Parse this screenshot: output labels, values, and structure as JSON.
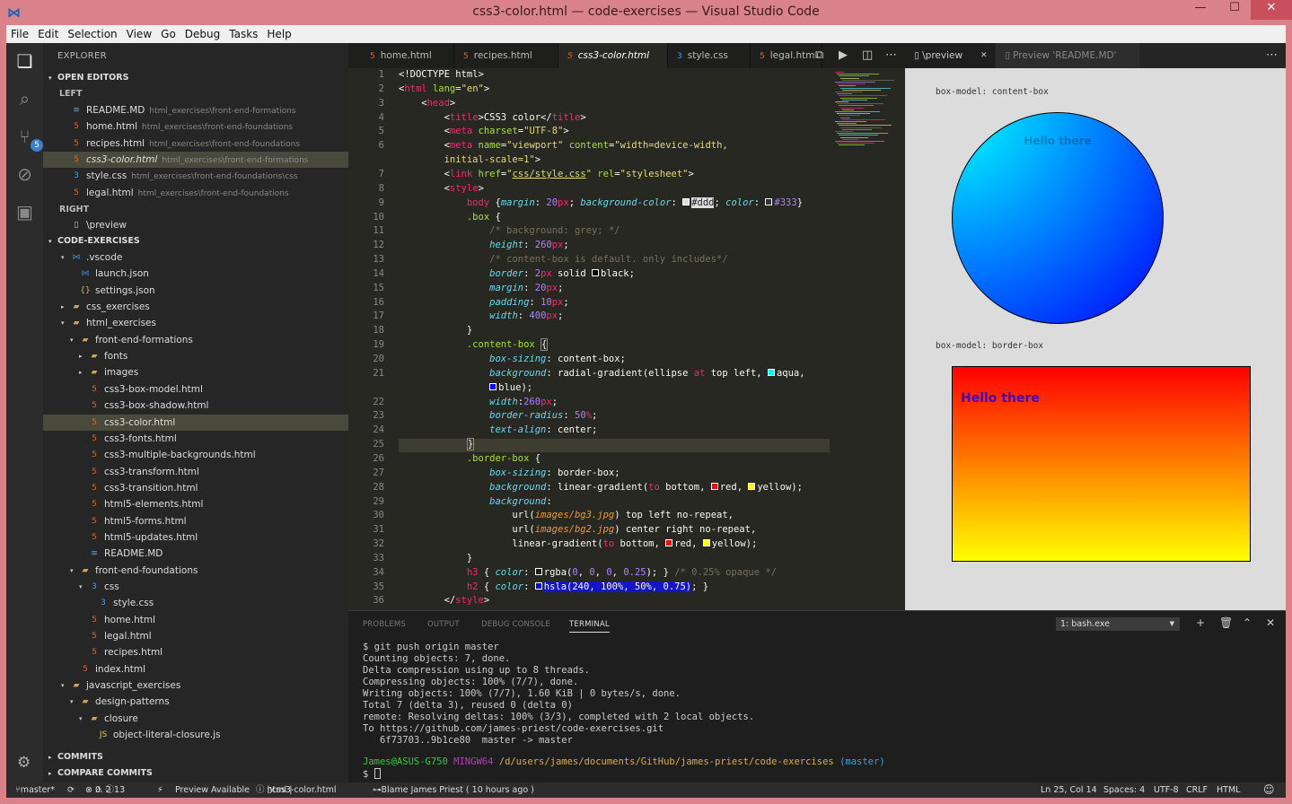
{
  "window": {
    "title": "css3-color.html — code-exercises — Visual Studio Code",
    "minimize": "—",
    "maximize": "☐",
    "close": "✕",
    "logo": "⋈"
  },
  "menu": [
    "File",
    "Edit",
    "Selection",
    "View",
    "Go",
    "Debug",
    "Tasks",
    "Help"
  ],
  "activity": {
    "git_badge": "5"
  },
  "sidebar": {
    "title": "EXPLORER",
    "open_editors": "OPEN EDITORS",
    "left_group": "LEFT",
    "right_group": "RIGHT",
    "open_left": [
      {
        "name": "README.MD",
        "path": "html_exercises\\front-end-formations",
        "type": "md"
      },
      {
        "name": "home.html",
        "path": "html_exercises\\front-end-foundations",
        "type": "html"
      },
      {
        "name": "recipes.html",
        "path": "html_exercises\\front-end-foundations",
        "type": "html"
      },
      {
        "name": "css3-color.html",
        "path": "html_exercises\\front-end-formations",
        "type": "html"
      },
      {
        "name": "style.css",
        "path": "html_exercises\\front-end-foundations\\css",
        "type": "css"
      },
      {
        "name": "legal.html",
        "path": "html_exercises\\front-end-foundations",
        "type": "html"
      }
    ],
    "open_right": [
      {
        "name": "\\preview",
        "type": "file"
      }
    ],
    "project": "CODE-EXERCISES",
    "tree": [
      {
        "name": ".vscode",
        "depth": 1,
        "type": "vs",
        "arrow": "▾"
      },
      {
        "name": "launch.json",
        "depth": 2,
        "type": "vs"
      },
      {
        "name": "settings.json",
        "depth": 2,
        "type": "json"
      },
      {
        "name": "css_exercises",
        "depth": 1,
        "type": "folder",
        "arrow": "▸"
      },
      {
        "name": "html_exercises",
        "depth": 1,
        "type": "folder",
        "arrow": "▾"
      },
      {
        "name": "front-end-formations",
        "depth": 2,
        "type": "folder",
        "arrow": "▾"
      },
      {
        "name": "fonts",
        "depth": 3,
        "type": "folder",
        "arrow": "▸"
      },
      {
        "name": "images",
        "depth": 3,
        "type": "folder",
        "arrow": "▸"
      },
      {
        "name": "css3-box-model.html",
        "depth": 3,
        "type": "html"
      },
      {
        "name": "css3-box-shadow.html",
        "depth": 3,
        "type": "html"
      },
      {
        "name": "css3-color.html",
        "depth": 3,
        "type": "html",
        "selected": true
      },
      {
        "name": "css3-fonts.html",
        "depth": 3,
        "type": "html"
      },
      {
        "name": "css3-multiple-backgrounds.html",
        "depth": 3,
        "type": "html"
      },
      {
        "name": "css3-transform.html",
        "depth": 3,
        "type": "html"
      },
      {
        "name": "css3-transition.html",
        "depth": 3,
        "type": "html"
      },
      {
        "name": "html5-elements.html",
        "depth": 3,
        "type": "html"
      },
      {
        "name": "html5-forms.html",
        "depth": 3,
        "type": "html"
      },
      {
        "name": "html5-updates.html",
        "depth": 3,
        "type": "html"
      },
      {
        "name": "README.MD",
        "depth": 3,
        "type": "md"
      },
      {
        "name": "front-end-foundations",
        "depth": 2,
        "type": "folder",
        "arrow": "▾"
      },
      {
        "name": "css",
        "depth": 3,
        "type": "css",
        "arrow": "▾"
      },
      {
        "name": "style.css",
        "depth": 4,
        "type": "css"
      },
      {
        "name": "home.html",
        "depth": 3,
        "type": "html"
      },
      {
        "name": "legal.html",
        "depth": 3,
        "type": "html"
      },
      {
        "name": "recipes.html",
        "depth": 3,
        "type": "html"
      },
      {
        "name": "index.html",
        "depth": 2,
        "type": "html"
      },
      {
        "name": "javascript_exercises",
        "depth": 1,
        "type": "folder",
        "arrow": "▾"
      },
      {
        "name": "design-patterns",
        "depth": 2,
        "type": "folder",
        "arrow": "▾"
      },
      {
        "name": "closure",
        "depth": 3,
        "type": "folder",
        "arrow": "▾"
      },
      {
        "name": "object-literal-closure.js",
        "depth": 4,
        "type": "js"
      }
    ],
    "commits": "COMMITS",
    "compare": "COMPARE COMMITS"
  },
  "editor_tabs": [
    {
      "name": "home.html",
      "type": "html"
    },
    {
      "name": "recipes.html",
      "type": "html"
    },
    {
      "name": "css3-color.html",
      "type": "html",
      "active": true
    },
    {
      "name": "style.css",
      "type": "css"
    },
    {
      "name": "legal.html",
      "type": "html"
    }
  ],
  "preview_tabs": [
    {
      "name": "\\preview",
      "close": "✕"
    },
    {
      "name": "Preview 'README.MD'"
    }
  ],
  "code_lines": [
    {
      "n": "1",
      "html": "<span class='w'>&lt;!DOCTYPE html&gt;</span>"
    },
    {
      "n": "2",
      "html": "<span class='w'>&lt;</span><span class='k'>html</span> <span class='a'>lang</span>=<span class='s'>\"en\"</span>&gt;"
    },
    {
      "n": "3",
      "html": "    &lt;<span class='k'>head</span>&gt;"
    },
    {
      "n": "4",
      "html": "        &lt;<span class='k'>title</span>&gt;CSS3 color&lt;/<span class='k'>title</span>&gt;"
    },
    {
      "n": "5",
      "html": "        &lt;<span class='k'>meta</span> <span class='a'>charset</span>=<span class='s'>\"UTF-8\"</span>&gt;"
    },
    {
      "n": "6",
      "html": "        &lt;<span class='k'>meta</span> <span class='a'>name</span>=<span class='s'>\"viewport\"</span> <span class='a'>content</span>=<span class='s'>\"width=device-width,</span>"
    },
    {
      "n": "",
      "html": "        <span class='s'>initial-scale=1\"</span>&gt;"
    },
    {
      "n": "7",
      "html": "        &lt;<span class='k'>link</span> <span class='a'>href</span>=<span class='s'>\"<u>css/style.css</u>\"</span> <span class='a'>rel</span>=<span class='s'>\"stylesheet\"</span>&gt;"
    },
    {
      "n": "8",
      "html": "        &lt;<span class='k'>style</span>&gt;"
    },
    {
      "n": "9",
      "html": "            <span class='k'>body</span> {<span class='p'>margin</span>: <span class='n'>20</span><span class='k'>px</span>; <span class='p'>background-color</span>: <span class='sw' style='background:#ddd'></span><span style='background:#ddd;color:#222'>#ddd</span>; <span class='p'>color</span>: <span class='sw' style='background:#333'></span><span class='n'>#333</span>}"
    },
    {
      "n": "10",
      "html": "            <span class='a'>.box</span> {"
    },
    {
      "n": "11",
      "html": "                <span class='c'>/* background: grey; */</span>"
    },
    {
      "n": "12",
      "html": "                <span class='p'>height</span>: <span class='n'>260</span><span class='k'>px</span>;"
    },
    {
      "n": "13",
      "html": "                <span class='c'>/* content-box is default. only includes*/</span>"
    },
    {
      "n": "14",
      "html": "                <span class='p'>border</span>: <span class='n'>2</span><span class='k'>px</span> solid <span class='sw' style='background:#000'></span>black;"
    },
    {
      "n": "15",
      "html": "                <span class='p'>margin</span>: <span class='n'>20</span><span class='k'>px</span>;"
    },
    {
      "n": "16",
      "html": "                <span class='p'>padding</span>: <span class='n'>10</span><span class='k'>px</span>;"
    },
    {
      "n": "17",
      "html": "                <span class='p'>width</span>: <span class='n'>400</span><span class='k'>px</span>;"
    },
    {
      "n": "18",
      "html": "            }"
    },
    {
      "n": "19",
      "html": "            <span class='a'>.content-box</span> <span style='border:1px solid #888'>{</span>"
    },
    {
      "n": "20",
      "html": "                <span class='p'>box-sizing</span>: content-box;"
    },
    {
      "n": "21",
      "html": "                <span class='p'>background</span>: radial-gradient(ellipse <span class='k'>at</span> top left, <span class='sw' style='background:#0ff'></span>aqua,"
    },
    {
      "n": "",
      "html": "                <span class='sw' style='background:#00f'></span>blue);"
    },
    {
      "n": "22",
      "html": "                <span class='p'>width</span>:<span class='n'>260</span><span class='k'>px</span>;"
    },
    {
      "n": "23",
      "html": "                <span class='p'>border-radius</span>: <span class='n'>50</span><span class='k'>%</span>;"
    },
    {
      "n": "24",
      "html": "                <span class='p'>text-align</span>: center;"
    },
    {
      "n": "25",
      "html": "            <span style='border:1px solid #888'>}</span>"
    },
    {
      "n": "26",
      "html": "            <span class='a'>.border-box</span> {"
    },
    {
      "n": "27",
      "html": "                <span class='p'>box-sizing</span>: border-box;"
    },
    {
      "n": "28",
      "html": "                <span class='p'>background</span>: linear-gradient(<span class='k'>to</span> bottom, <span class='sw' style='background:red'></span>red, <span class='sw' style='background:yellow'></span>yellow);"
    },
    {
      "n": "29",
      "html": "                <span class='p'>background</span>:"
    },
    {
      "n": "30",
      "html": "                    url(<span class='o'>images/bg3.jpg</span>) top left no-repeat,"
    },
    {
      "n": "31",
      "html": "                    url(<span class='o'>images/bg2.jpg</span>) center right no-repeat,"
    },
    {
      "n": "32",
      "html": "                    linear-gradient(<span class='k'>to</span> bottom, <span class='sw' style='background:red'></span>red, <span class='sw' style='background:yellow'></span>yellow);"
    },
    {
      "n": "33",
      "html": "            }"
    },
    {
      "n": "34",
      "html": "            <span class='k'>h3</span> { <span class='p'>color</span>: <span class='sw' style='background:rgba(0,0,0,0.25)'></span>rgba(<span class='n'>0</span>, <span class='n'>0</span>, <span class='n'>0</span>, <span class='n'>0.25</span>); } <span class='c'>/* 0.25% opaque */</span>"
    },
    {
      "n": "35",
      "html": "            <span class='k'>h2</span> { <span class='p'>color</span>: <span class='sw' style='background:#00f'></span><span style='background:#1515c8'>hsla(240, 100%, 50%, 0.75)</span>; }"
    },
    {
      "n": "36",
      "html": "        &lt;/<span class='k'>style</span>&gt;"
    }
  ],
  "preview": {
    "label1": "box-model: content-box",
    "h3_text": "Hello there",
    "label2": "box-model: border-box",
    "h2_text": "Hello there"
  },
  "panel": {
    "tabs": [
      "PROBLEMS",
      "OUTPUT",
      "DEBUG CONSOLE",
      "TERMINAL"
    ],
    "terminal_select": "1: bash.exe",
    "terminal_lines": [
      "$ git push origin master",
      "Counting objects: 7, done.",
      "Delta compression using up to 8 threads.",
      "Compressing objects: 100% (7/7), done.",
      "Writing objects: 100% (7/7), 1.60 KiB | 0 bytes/s, done.",
      "Total 7 (delta 3), reused 0 (delta 0)",
      "remote: Resolving deltas: 100% (3/3), completed with 2 local objects.",
      "To https://github.com/james-priest/code-exercises.git",
      "   6f73703..9b1ce80  master -> master"
    ],
    "prompt_user": "James@ASUS-G750",
    "prompt_env": "MINGW64",
    "prompt_path": "/d/users/james/documents/GitHub/james-priest/code-exercises",
    "prompt_branch": "(master)",
    "prompt": "$"
  },
  "status": {
    "branch": "master*",
    "errors": "0",
    "warnings": "2",
    "info": "13",
    "preview": "Preview Available",
    "lang_file": "html | ",
    "file": "css3-color.html",
    "blame": "Blame James Priest ( 10 hours ago )",
    "position": "Ln 25, Col 14",
    "spaces": "Spaces: 4",
    "encoding": "UTF-8",
    "eol": "CRLF",
    "language": "HTML"
  },
  "colors": {
    "accent": "#3d7fc9",
    "titlebar": "#d9828a",
    "editor_bg": "#272822"
  }
}
